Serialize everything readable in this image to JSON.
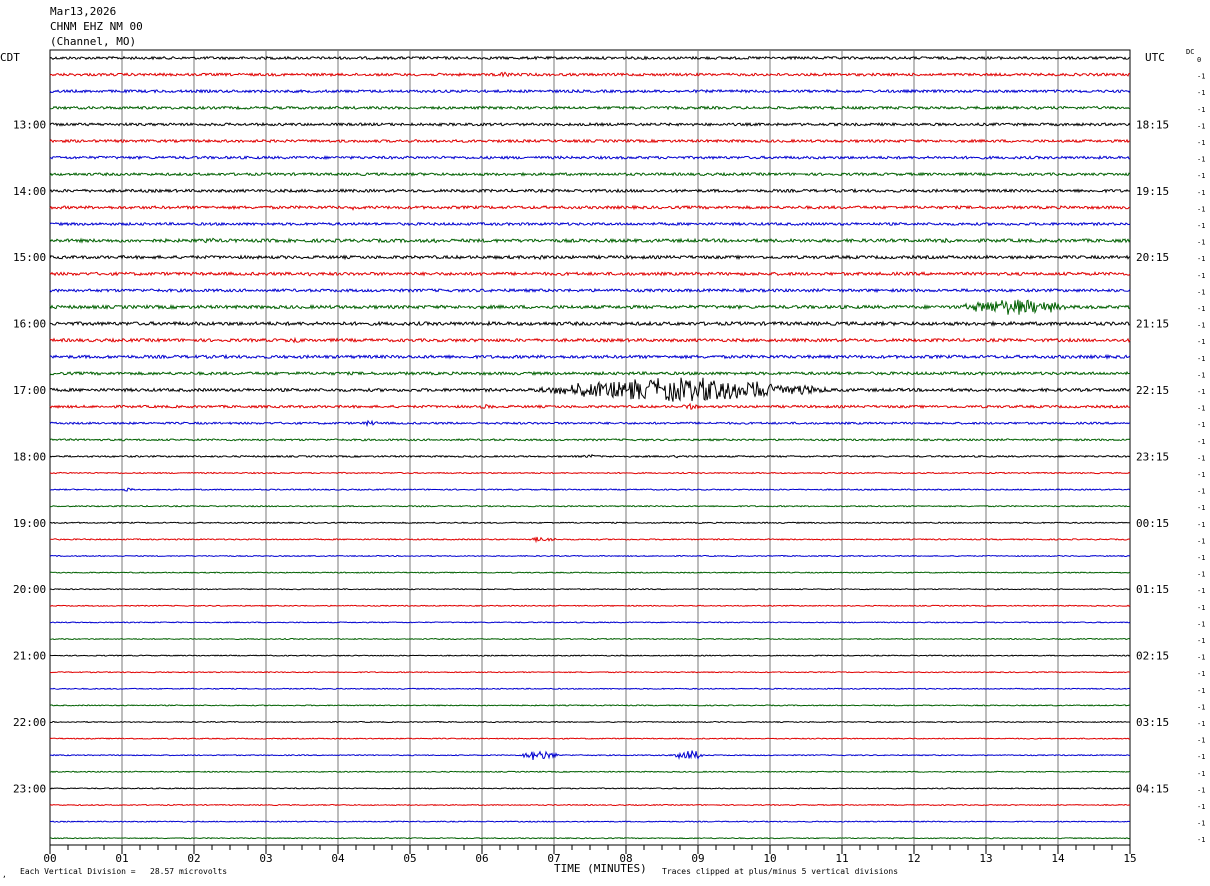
{
  "header": {
    "date": "Mar13,2026",
    "station": "CHNM EHZ NM 00",
    "location": "(Channel, MO)"
  },
  "left_timezone": "CDT",
  "right_timezone": "UTC",
  "dc_label": "DC",
  "footer": {
    "left_mark": "‚",
    "scale": "Each Vertical Division =   28.57 microvolts",
    "xlabel": "TIME (MINUTES)",
    "clip_note": "Traces clipped at plus/minus 5 vertical divisions"
  },
  "chart_data": {
    "type": "line",
    "title": "",
    "xlabel": "TIME (MINUTES)",
    "xlim": [
      0,
      15
    ],
    "x_ticks": [
      "00",
      "01",
      "02",
      "03",
      "04",
      "05",
      "06",
      "07",
      "08",
      "09",
      "10",
      "11",
      "12",
      "13",
      "14",
      "15"
    ],
    "lines_per_hour": 4,
    "minutes_per_line": 15,
    "line_count": 48,
    "left_hour_labels": [
      "13:00",
      "14:00",
      "15:00",
      "16:00",
      "17:00",
      "18:00",
      "19:00",
      "20:00",
      "21:00",
      "22:00",
      "23:00"
    ],
    "right_hour_labels": [
      "18:15",
      "19:15",
      "20:15",
      "21:15",
      "22:15",
      "23:15",
      "00:15",
      "01:15",
      "02:15",
      "03:15",
      "04:15"
    ],
    "first_hour_label_line": 4,
    "dc_offsets": [
      "0",
      "-1",
      "-1",
      "-1",
      "-1",
      "-1",
      "-1",
      "-1",
      "-1",
      "-1",
      "-1",
      "-1",
      "-1",
      "-1",
      "-1",
      "-1",
      "-1",
      "-1",
      "-1",
      "-1",
      "-1",
      "-1",
      "-1",
      "-1",
      "-1",
      "-1",
      "-1",
      "-1",
      "-1",
      "-1",
      "-1",
      "-1",
      "-1",
      "-1",
      "-1",
      "-1",
      "-1",
      "-1",
      "-1",
      "-1",
      "-1",
      "-1",
      "-1",
      "-1",
      "-1",
      "-1",
      "-1",
      "-1"
    ],
    "trace_colors": [
      "#000000",
      "#e00000",
      "#0000d0",
      "#006000"
    ],
    "noise_levels": [
      1.3,
      1.3,
      1.3,
      1.3,
      1.3,
      1.3,
      1.3,
      1.3,
      1.4,
      1.4,
      1.3,
      1.6,
      1.5,
      1.5,
      1.4,
      1.6,
      1.7,
      1.5,
      1.5,
      1.4,
      1.5,
      1.2,
      1.0,
      0.9,
      0.8,
      0.6,
      0.6,
      0.6,
      0.6,
      0.6,
      0.5,
      0.5,
      0.5,
      0.5,
      0.5,
      0.5,
      0.5,
      0.5,
      0.5,
      0.5,
      0.5,
      0.5,
      0.5,
      0.5,
      0.5,
      0.5,
      0.5,
      0.5
    ],
    "events": [
      {
        "line": 1,
        "start_min": 6.2,
        "end_min": 6.45,
        "amplitude": 4
      },
      {
        "line": 9,
        "start_min": 4.1,
        "end_min": 4.4,
        "amplitude": 3
      },
      {
        "line": 11,
        "start_min": 2.1,
        "end_min": 2.35,
        "amplitude": 3
      },
      {
        "line": 11,
        "start_min": 3.1,
        "end_min": 3.35,
        "amplitude": 3
      },
      {
        "line": 11,
        "start_min": 5.2,
        "end_min": 5.45,
        "amplitude": 3
      },
      {
        "line": 11,
        "start_min": 12.3,
        "end_min": 12.6,
        "amplitude": 3
      },
      {
        "line": 12,
        "start_min": 6.7,
        "end_min": 6.95,
        "amplitude": 4
      },
      {
        "line": 13,
        "start_min": 3.4,
        "end_min": 3.7,
        "amplitude": 4
      },
      {
        "line": 15,
        "start_min": 12.5,
        "end_min": 14.3,
        "amplitude": 9
      },
      {
        "line": 17,
        "start_min": 3.3,
        "end_min": 3.55,
        "amplitude": 4
      },
      {
        "line": 20,
        "start_min": 6.5,
        "end_min": 11.1,
        "amplitude": 13
      },
      {
        "line": 21,
        "start_min": 5.9,
        "end_min": 6.2,
        "amplitude": 3
      },
      {
        "line": 21,
        "start_min": 8.7,
        "end_min": 9.1,
        "amplitude": 3
      },
      {
        "line": 22,
        "start_min": 4.3,
        "end_min": 4.6,
        "amplitude": 3
      },
      {
        "line": 24,
        "start_min": 7.3,
        "end_min": 7.7,
        "amplitude": 2
      },
      {
        "line": 24,
        "start_min": 8.6,
        "end_min": 8.9,
        "amplitude": 2
      },
      {
        "line": 26,
        "start_min": 0.95,
        "end_min": 1.2,
        "amplitude": 2
      },
      {
        "line": 29,
        "start_min": 6.6,
        "end_min": 7.1,
        "amplitude": 3
      },
      {
        "line": 42,
        "start_min": 6.5,
        "end_min": 7.1,
        "amplitude": 6
      },
      {
        "line": 42,
        "start_min": 8.6,
        "end_min": 9.1,
        "amplitude": 7
      }
    ]
  }
}
